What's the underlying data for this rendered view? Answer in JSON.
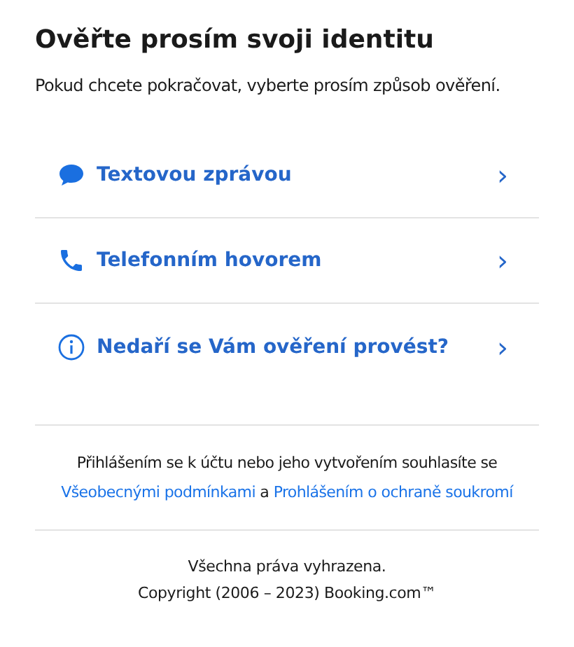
{
  "title": "Ověřte prosím svoji identitu",
  "subtitle": "Pokud chcete pokračovat, vyberte prosím způsob ověření.",
  "options": [
    {
      "kind": "sms",
      "label": "Textovou zprávou",
      "arrow": "›"
    },
    {
      "kind": "phone",
      "label": "Telefonním hovorem",
      "arrow": "›"
    },
    {
      "kind": "help",
      "label": "Nedaří se Vám ověření provést?",
      "arrow": "›"
    }
  ],
  "legal": {
    "text": "Přihlášením se k účtu nebo jeho vytvořením souhlasíte se",
    "terms_link": "Všeobecnými podmínkami",
    "joiner": "a",
    "privacy_link": "Prohlášením o ochraně soukromí"
  },
  "footer": [
    "Všechna práva vyhrazena.",
    "Copyright (2006 – 2023) Booking.com™"
  ]
}
